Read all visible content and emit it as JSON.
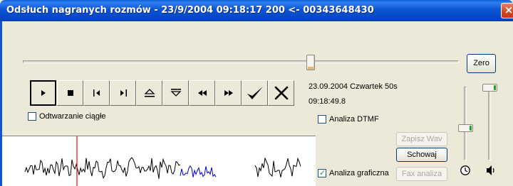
{
  "window": {
    "title": "Odsłuch nagranych rozmów - 23/9/2004 09:18:17 200 <- 00343648430",
    "close_icon": "close-icon"
  },
  "position": {
    "fraction": 0.66
  },
  "zero_label": "Zero",
  "toolbar": {
    "buttons": [
      {
        "name": "play",
        "icon": "play-icon",
        "pressed": true
      },
      {
        "name": "stop",
        "icon": "stop-icon"
      },
      {
        "name": "mark-start",
        "icon": "mark-start-icon"
      },
      {
        "name": "mark-end",
        "icon": "mark-end-icon"
      },
      {
        "name": "eject-up",
        "icon": "eject-icon"
      },
      {
        "name": "eject-down",
        "icon": "eject-down-icon"
      },
      {
        "name": "rewind",
        "icon": "rewind-icon"
      },
      {
        "name": "fast-forward",
        "icon": "fast-forward-icon"
      },
      {
        "name": "accept",
        "icon": "checkmark-icon"
      },
      {
        "name": "reject",
        "icon": "x-icon"
      }
    ]
  },
  "info": {
    "date_line": "23.09.2004 Czwartek  50s",
    "time_line": "09:18:49.8"
  },
  "options": {
    "continuous_label": "Odtwarzanie ciągłe",
    "continuous_checked": false,
    "dtmf_label": "Analiza DTMF",
    "dtmf_checked": false,
    "graphic_label": "Analiza graficzna",
    "graphic_checked": true
  },
  "actions": {
    "save_wav": "Zapisz Wav",
    "hide": "Schowaj",
    "fax": "Fax analiza"
  },
  "sliders": {
    "speed_icon": "clock-icon",
    "volume_icon": "speaker-icon",
    "speed_level": 0.45,
    "volume_level": 1.0
  },
  "colors": {
    "title_blue": "#0b55d6",
    "cursor_red": "#ff0000",
    "wave_blue": "#0000cc"
  }
}
